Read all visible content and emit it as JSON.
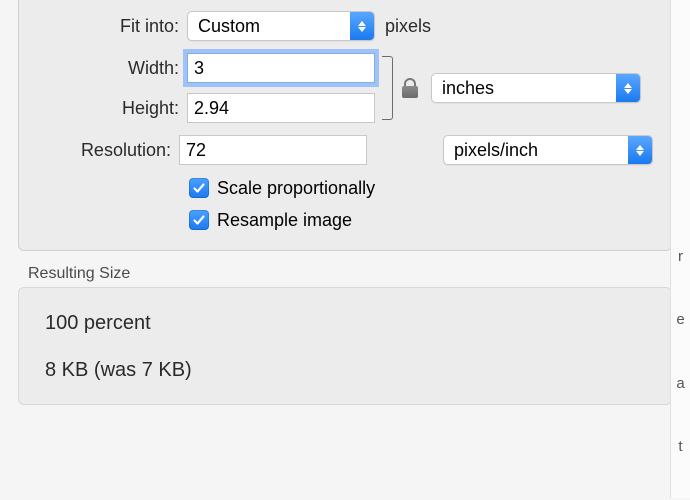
{
  "fit": {
    "label": "Fit into:",
    "value": "Custom",
    "suffix": "pixels"
  },
  "width": {
    "label": "Width:",
    "value": "3"
  },
  "height": {
    "label": "Height:",
    "value": "2.94"
  },
  "dimension_unit": "inches",
  "resolution": {
    "label": "Resolution:",
    "value": "72",
    "unit": "pixels/inch"
  },
  "checks": {
    "scale": "Scale proportionally",
    "resample": "Resample image"
  },
  "result": {
    "title": "Resulting Size",
    "percent": "100 percent",
    "size": "8 KB (was 7 KB)"
  },
  "strip": [
    "r",
    "e",
    "a",
    "t"
  ]
}
